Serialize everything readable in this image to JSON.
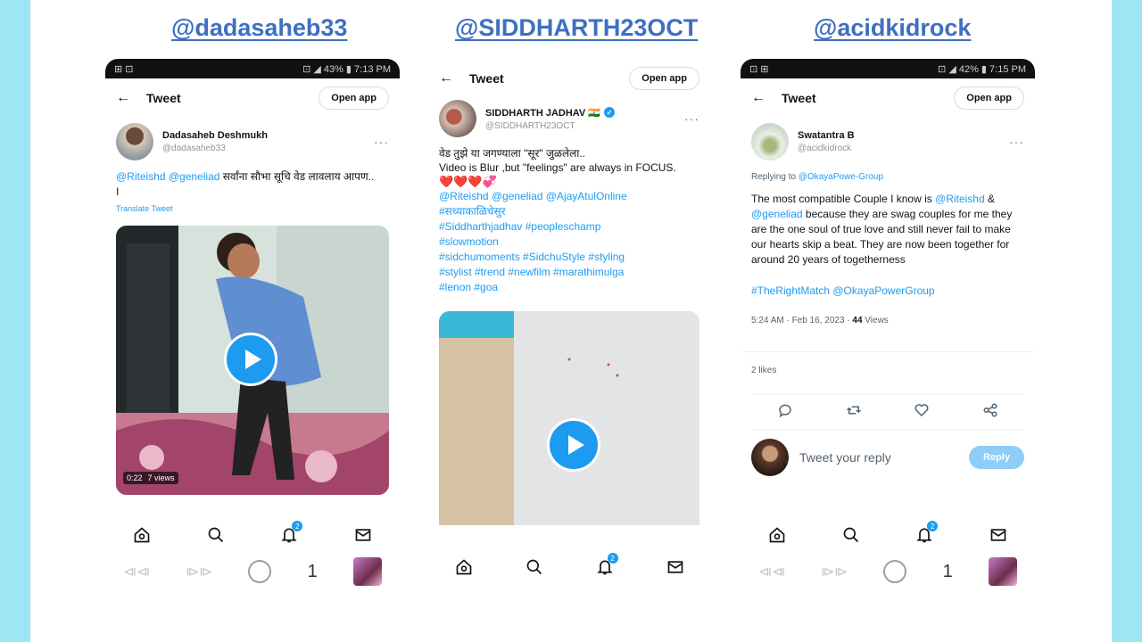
{
  "handles": [
    "@dadasaheb33",
    "@SIDDHARTH23OCT",
    "@acidkidrock"
  ],
  "phone1": {
    "status_left": "⊞ ⊡",
    "status_right": "⊡ ◢ 43% ▮ 7:13 PM",
    "title": "Tweet",
    "open_app": "Open app",
    "display_name": "Dadasaheb Deshmukh",
    "username": "@dadasaheb33",
    "text_links": "@Riteishd @geneliad",
    "text": " सर्वांना सौभा सूचि वेड लावलाय आपण..",
    "text_line2": "I",
    "translate": "Translate Tweet",
    "video_time": "0:22",
    "video_views": "7 views"
  },
  "phone2": {
    "title": "Tweet",
    "open_app": "Open app",
    "display_name": "SIDDHARTH JADHAV 🇮🇳",
    "username": "@SIDDHARTH23OCT",
    "line1": "वेड तुझे या जगण्याला \"सूर\" जुळलेला..",
    "line2": "Video is Blur ,but \"feelings\" are always in FOCUS.",
    "hearts": "❤️❤️❤️💞",
    "hashtags": [
      "@Riteishd @geneliad @AjayAtulOnline",
      "#सध्याकाळिचेसुर",
      "#Siddharthjadhav #peopleschamp",
      "#slowmotion",
      "#sidchumoments #SidchuStyle #styling",
      "#stylist #trend #newfilm #marathimulga",
      "#lenon #goa"
    ]
  },
  "phone3": {
    "status_left": "⊡ ⊞",
    "status_right": "⊡ ◢ 42% ▮ 7:15 PM",
    "title": "Tweet",
    "open_app": "Open app",
    "display_name": "Swatantra B",
    "username": "@acidkidrock",
    "replying_label": "Replying to ",
    "replying_to": "@OkayaPowe-Group",
    "text_a": "The most compatible Couple I know is ",
    "mention1": "@Riteishd",
    "text_b": " & ",
    "mention2": "@geneliad",
    "text_c": " because they are swag couples for me they are the one soul of true love and still never fail to make our hearts skip a beat. They are now been together for around 20 years of togetherness",
    "hashtags": "#TheRightMatch @OkayaPowerGroup",
    "timestamp": "5:24 AM · Feb 16, 2023 · ",
    "views_count": "44",
    "views_label": " Views",
    "likes": "2 likes",
    "reply_placeholder": "Tweet your reply",
    "reply_button": "Reply"
  },
  "nav_badge": "2",
  "sysnav_number": "1",
  "colors": {
    "accent": "#1d9bf0",
    "handle": "#3e6fc2",
    "border_bg": "#9de7f4"
  }
}
